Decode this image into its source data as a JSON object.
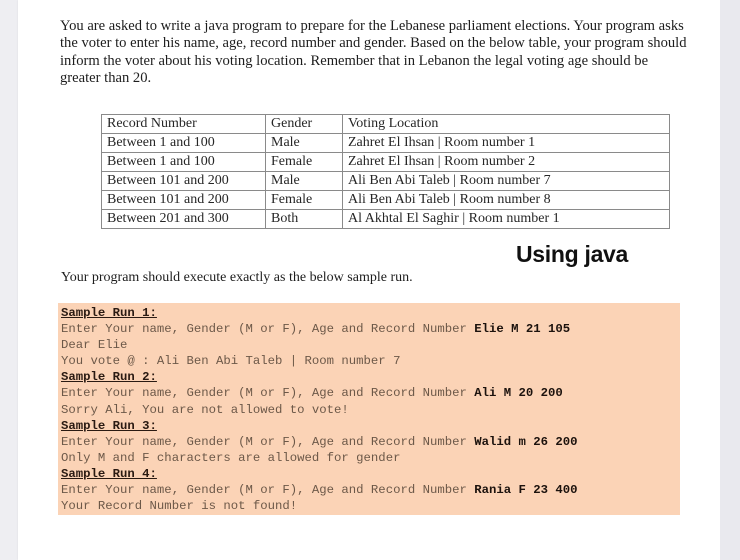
{
  "intro_paragraph": "You are asked to write a java program to prepare for the Lebanese parliament elections. Your program asks the voter to enter his name, age, record number and gender. Based on the below table, your program should inform the voter about his voting location. Remember that in Lebanon the legal voting age should be greater than 20.",
  "table": {
    "headers": [
      "Record Number",
      "Gender",
      "Voting Location"
    ],
    "rows": [
      [
        "Between 1 and 100",
        "Male",
        "Zahret El Ihsan | Room number 1"
      ],
      [
        "Between 1 and 100",
        "Female",
        "Zahret El Ihsan | Room number 2"
      ],
      [
        "Between 101 and 200",
        "Male",
        "Ali Ben Abi Taleb | Room number 7"
      ],
      [
        "Between 101 and 200",
        "Female",
        "Ali Ben Abi Taleb | Room number 8"
      ],
      [
        "Between 201 and 300",
        "Both",
        "Al Akhtal El Saghir | Room number 1"
      ]
    ]
  },
  "annotation": "Using java",
  "instruction": "Your program should execute exactly as the below sample run.",
  "sample_runs": [
    {
      "title": "Sample Run 1:",
      "prompt": "Enter Your name, Gender (M or F), Age and Record Number ",
      "input": "Elie M 21 105",
      "output": [
        "Dear Elie",
        "You vote @ : Ali Ben Abi Taleb | Room number 7"
      ]
    },
    {
      "title": "Sample Run 2:",
      "prompt": "Enter Your name, Gender (M or F), Age and Record Number ",
      "input": "Ali M 20 200",
      "output": [
        "Sorry Ali, You are not allowed to vote!"
      ]
    },
    {
      "title": "Sample Run 3:",
      "prompt": "Enter Your name, Gender (M or F), Age and Record Number ",
      "input": "Walid m 26 200",
      "output": [
        "Only M and F characters are allowed for gender"
      ]
    },
    {
      "title": "Sample Run 4:",
      "prompt": "Enter Your name, Gender (M or F), Age and Record Number ",
      "input": "Rania F 23 400",
      "output": [
        "Your Record Number is not found!"
      ]
    }
  ],
  "colors": {
    "sample_background": "#fbd3b6",
    "page_background": "#ffffff"
  }
}
